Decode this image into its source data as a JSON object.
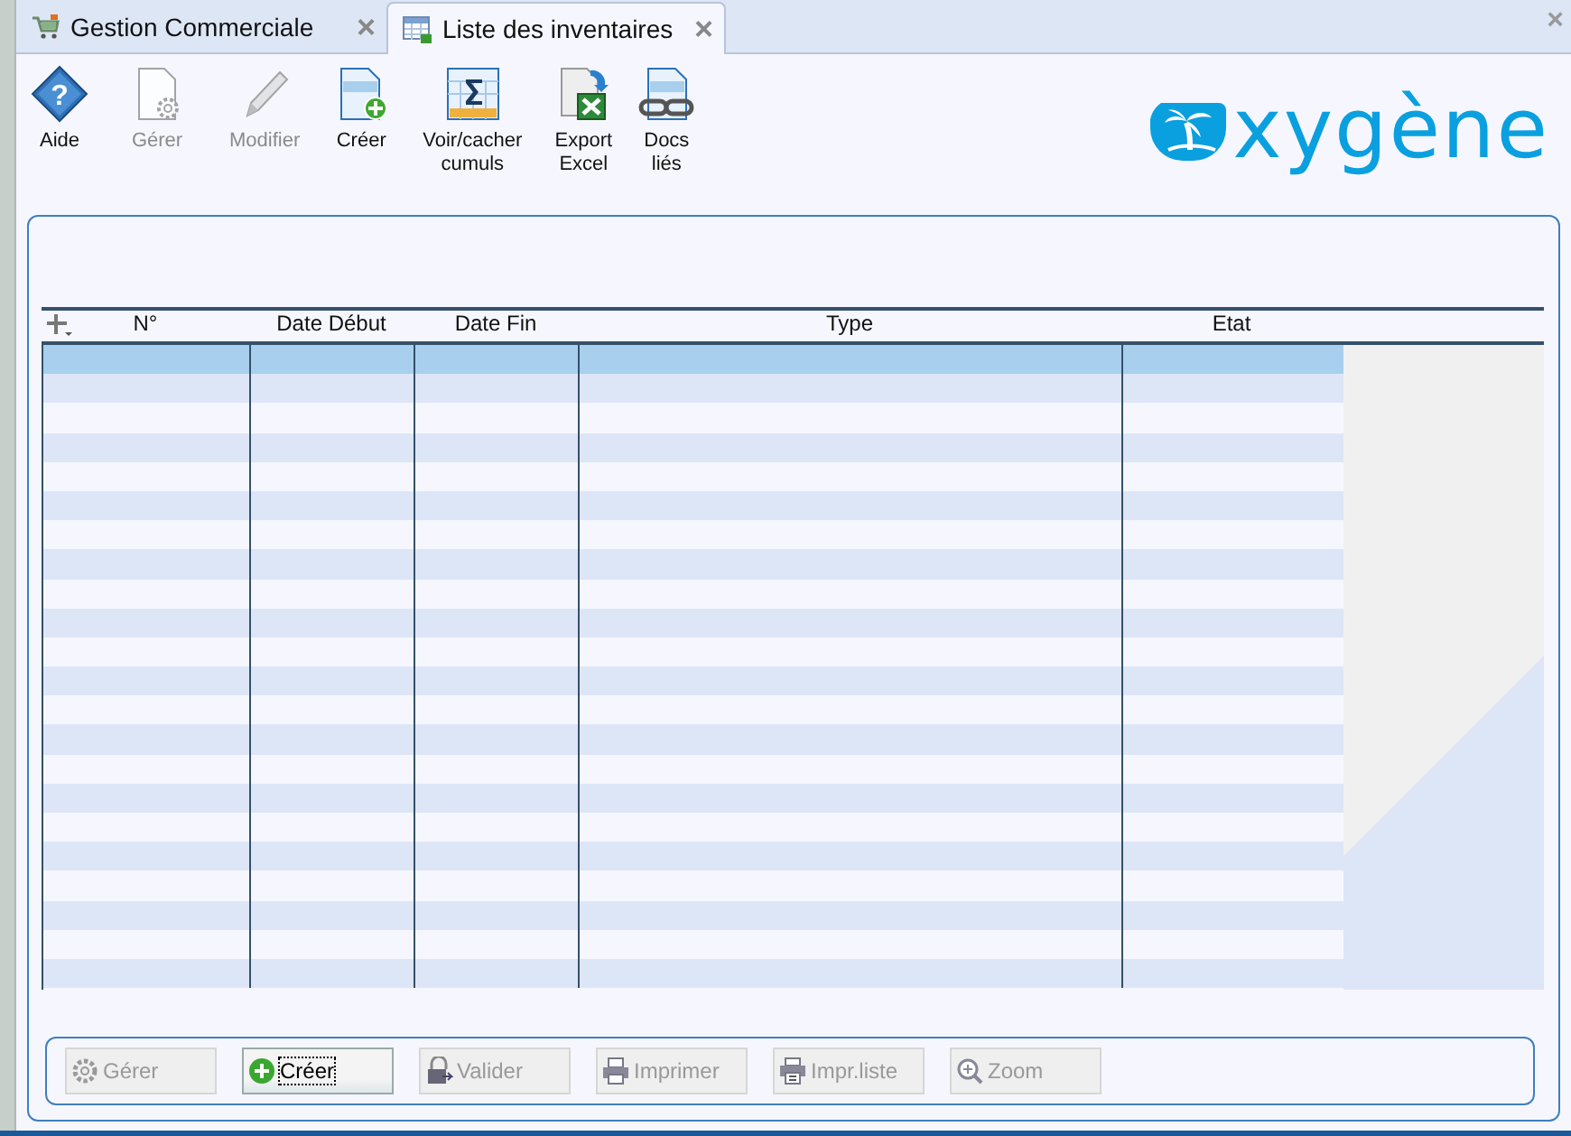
{
  "tabs": [
    {
      "label": "Gestion Commerciale",
      "selected": false,
      "close": "×"
    },
    {
      "label": "Liste des inventaires",
      "selected": true,
      "close": "×"
    }
  ],
  "window_close": "×",
  "help_glyph": "?",
  "toolbar": [
    {
      "label": "Aide",
      "disabled": false
    },
    {
      "label": "Gérer",
      "disabled": true
    },
    {
      "label": "Modifier",
      "disabled": true
    },
    {
      "label": "Créer",
      "disabled": false
    },
    {
      "label": "Voir/cacher cumuls",
      "disabled": false
    },
    {
      "label": "Export Excel",
      "disabled": false
    },
    {
      "label": "Docs liés",
      "disabled": false
    }
  ],
  "logo": {
    "text": "xygène"
  },
  "table": {
    "columns": [
      "N°",
      "Date Début",
      "Date Fin",
      "Type",
      "Etat"
    ],
    "rows": [
      {
        "selected": true
      },
      {
        "selected": false
      },
      {
        "selected": false
      },
      {
        "selected": false
      },
      {
        "selected": false
      },
      {
        "selected": false
      },
      {
        "selected": false
      },
      {
        "selected": false
      },
      {
        "selected": false
      },
      {
        "selected": false
      },
      {
        "selected": false
      },
      {
        "selected": false
      },
      {
        "selected": false
      },
      {
        "selected": false
      },
      {
        "selected": false
      },
      {
        "selected": false
      },
      {
        "selected": false
      },
      {
        "selected": false
      },
      {
        "selected": false
      },
      {
        "selected": false
      },
      {
        "selected": false
      },
      {
        "selected": false
      }
    ]
  },
  "buttons": [
    {
      "label": "Gérer",
      "disabled": true
    },
    {
      "label": "Créer",
      "disabled": false
    },
    {
      "label": "Valider",
      "disabled": true
    },
    {
      "label": "Imprimer",
      "disabled": true
    },
    {
      "label": "Impr.liste",
      "disabled": true
    },
    {
      "label": "Zoom",
      "disabled": true
    }
  ]
}
